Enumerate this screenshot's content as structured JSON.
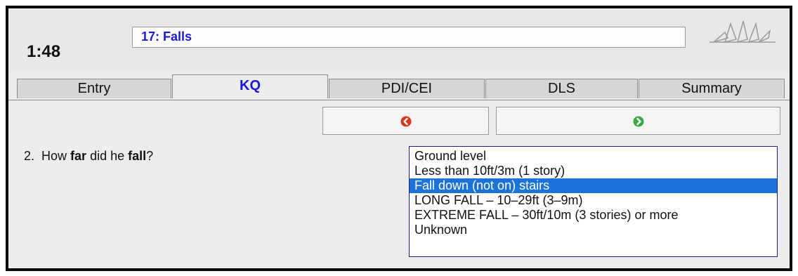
{
  "header": {
    "timer": "1:48",
    "protocol_title": "17:  Falls"
  },
  "tabs": [
    {
      "label": "Entry",
      "active": false
    },
    {
      "label": "KQ",
      "active": true
    },
    {
      "label": "PDI/CEI",
      "active": false
    },
    {
      "label": "DLS",
      "active": false
    },
    {
      "label": "Summary",
      "active": false
    }
  ],
  "nav": {
    "back_icon": "back-arrow-icon",
    "forward_icon": "forward-arrow-icon",
    "back_color": "#d9361f",
    "forward_color": "#3aa845"
  },
  "question": {
    "number": "2.",
    "pre": "How ",
    "bold1": "far",
    "mid": " did he ",
    "bold2": "fall",
    "post": "?"
  },
  "answers": {
    "options": [
      "Ground level",
      "Less than 10ft/3m (1 story)",
      "Fall down (not on) stairs",
      "LONG FALL – 10–29ft (3–9m)",
      "EXTREME FALL – 30ft/10m (3 stories) or more",
      "Unknown"
    ],
    "selected": "Fall down (not on) stairs"
  },
  "colors": {
    "accent": "#1a1ad6",
    "selection": "#1a73d9"
  }
}
